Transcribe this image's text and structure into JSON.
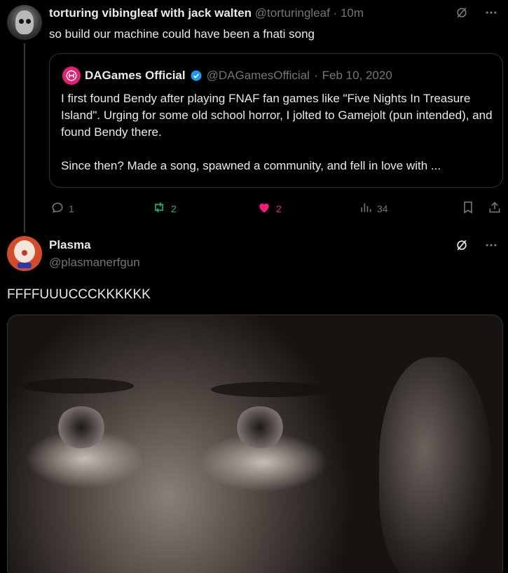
{
  "tweet1": {
    "display_name": "torturing vibingleaf with jack walten",
    "handle": "@torturingleaf",
    "separator": "·",
    "time": "10m",
    "text": "so build our machine could have been a fnati song",
    "quote": {
      "display_name": "DAGames Official",
      "handle": "@DAGamesOfficial",
      "separator": "·",
      "date": "Feb 10, 2020",
      "paragraph1": "I first found Bendy after playing FNAF fan games like \"Five Nights In Treasure Island\". Urging for some old school horror, I jolted to Gamejolt (pun intended), and found Bendy there.",
      "paragraph2": "Since then? Made a song, spawned a community, and fell in love with ..."
    },
    "actions": {
      "replies": "1",
      "retweets": "2",
      "likes": "2",
      "views": "34"
    }
  },
  "tweet2": {
    "display_name": "Plasma",
    "handle": "@plasmanerfgun",
    "text": "FFFFUUUCCCKKKKKK"
  },
  "icons": {
    "grok": "grok-icon",
    "more": "more-icon",
    "reply": "reply-icon",
    "retweet": "retweet-icon",
    "like": "heart-icon",
    "views": "views-icon",
    "bookmark": "bookmark-icon",
    "share": "share-icon",
    "verified": "verified-badge-icon"
  },
  "colors": {
    "background": "#000000",
    "text": "#e7e9ea",
    "muted": "#71767b",
    "retweet_green": "#00ba7c",
    "like_pink": "#f91880",
    "verified_blue": "#1d9bf0"
  }
}
